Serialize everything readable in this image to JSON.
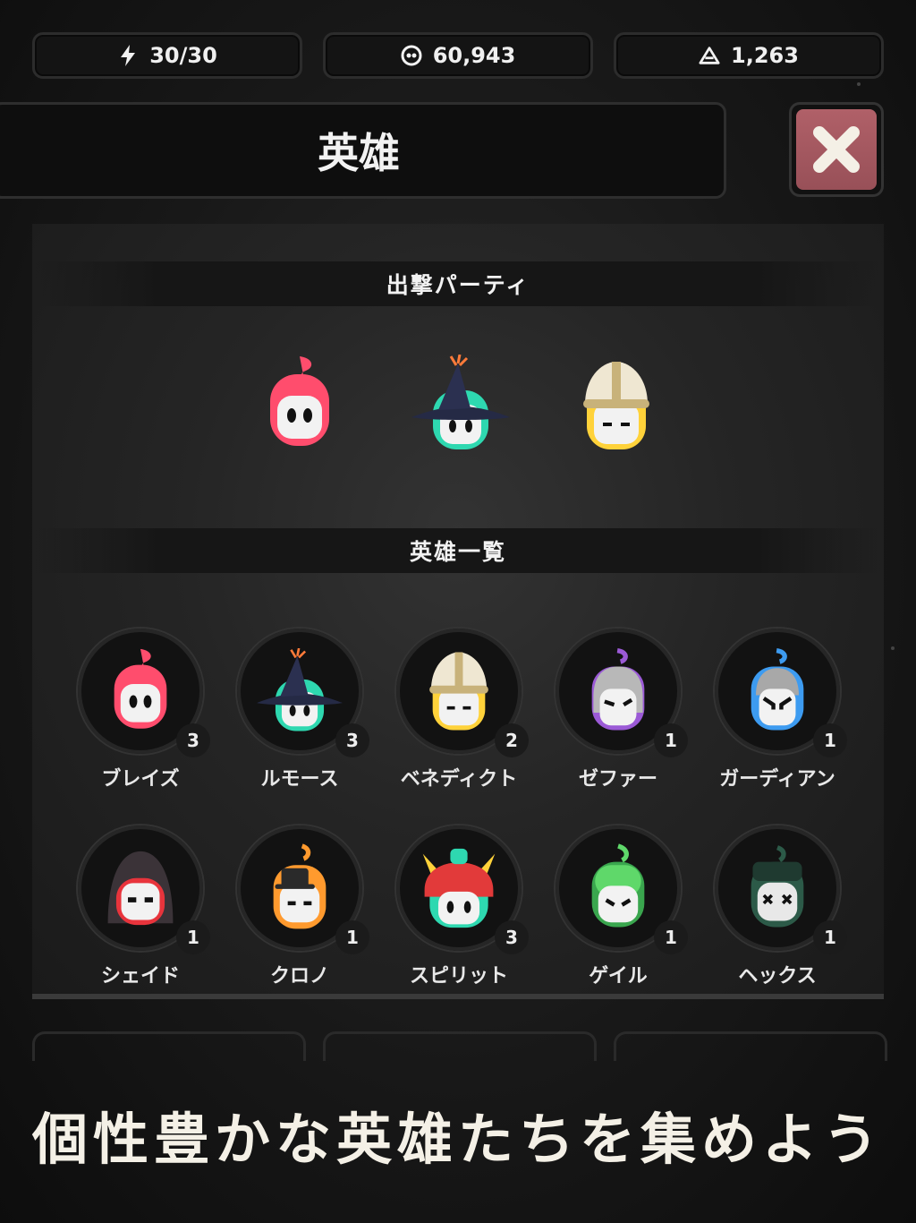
{
  "resources": {
    "energy": {
      "icon": "lightning-icon",
      "value": "30/30"
    },
    "coins": {
      "icon": "coin-icon",
      "value": "60,943"
    },
    "gems": {
      "icon": "triangle-gem-icon",
      "value": "1,263"
    }
  },
  "header": {
    "title": "英雄",
    "close_icon": "close-icon"
  },
  "party": {
    "heading": "出撃パーティ",
    "members": [
      {
        "hero": "ブレイズ",
        "color": "#ff4d6d"
      },
      {
        "hero": "ルモース",
        "color": "#2ed8b0"
      },
      {
        "hero": "ベネディクト",
        "color": "#ffd23a"
      }
    ]
  },
  "hero_list": {
    "heading": "英雄一覧",
    "heroes": [
      {
        "name": "ブレイズ",
        "level": "3",
        "color": "#ff4d6d"
      },
      {
        "name": "ルモース",
        "level": "3",
        "color": "#2ed8b0"
      },
      {
        "name": "ベネディクト",
        "level": "2",
        "color": "#ffd23a"
      },
      {
        "name": "ゼファー",
        "level": "1",
        "color": "#9b5ad6"
      },
      {
        "name": "ガーディアン",
        "level": "1",
        "color": "#3d9bf0"
      },
      {
        "name": "シェイド",
        "level": "1",
        "color": "#e8343c"
      },
      {
        "name": "クロノ",
        "level": "1",
        "color": "#ff9a2e"
      },
      {
        "name": "スピリット",
        "level": "3",
        "color": "#2ed8b0"
      },
      {
        "name": "ゲイル",
        "level": "1",
        "color": "#5fd86a"
      },
      {
        "name": "ヘックス",
        "level": "1",
        "color": "#2c5a48"
      }
    ]
  },
  "caption": "個性豊かな英雄たちを集めよう"
}
